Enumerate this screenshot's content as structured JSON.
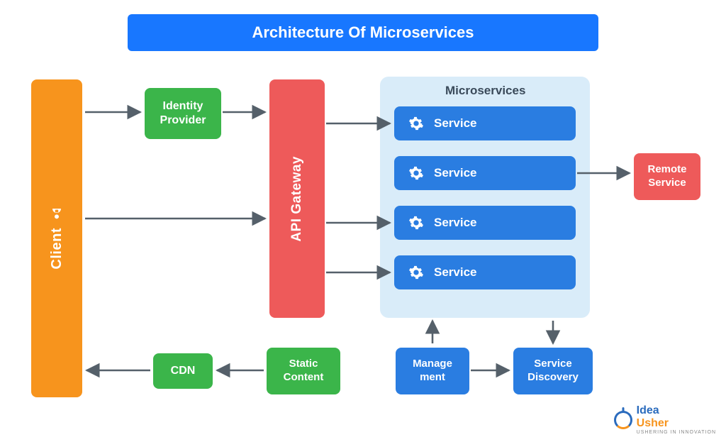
{
  "title": "Architecture Of Microservices",
  "client": "Client",
  "identity_provider": "Identity\nProvider",
  "api_gateway": "API Gateway",
  "microservices_title": "Microservices",
  "services": [
    "Service",
    "Service",
    "Service",
    "Service"
  ],
  "remote_service": "Remote\nService",
  "management": "Manage\nment",
  "service_discovery": "Service\nDiscovery",
  "static_content": "Static\nContent",
  "cdn": "CDN",
  "brand": {
    "name": "Idea",
    "sub": "Usher",
    "tag": "USHERING IN INNOVATION"
  },
  "colors": {
    "orange": "#f7941d",
    "green": "#3bb54a",
    "red": "#ee5a5a",
    "blue": "#2a7de1",
    "pale": "#d9ecf9",
    "title_blue": "#1877ff"
  }
}
